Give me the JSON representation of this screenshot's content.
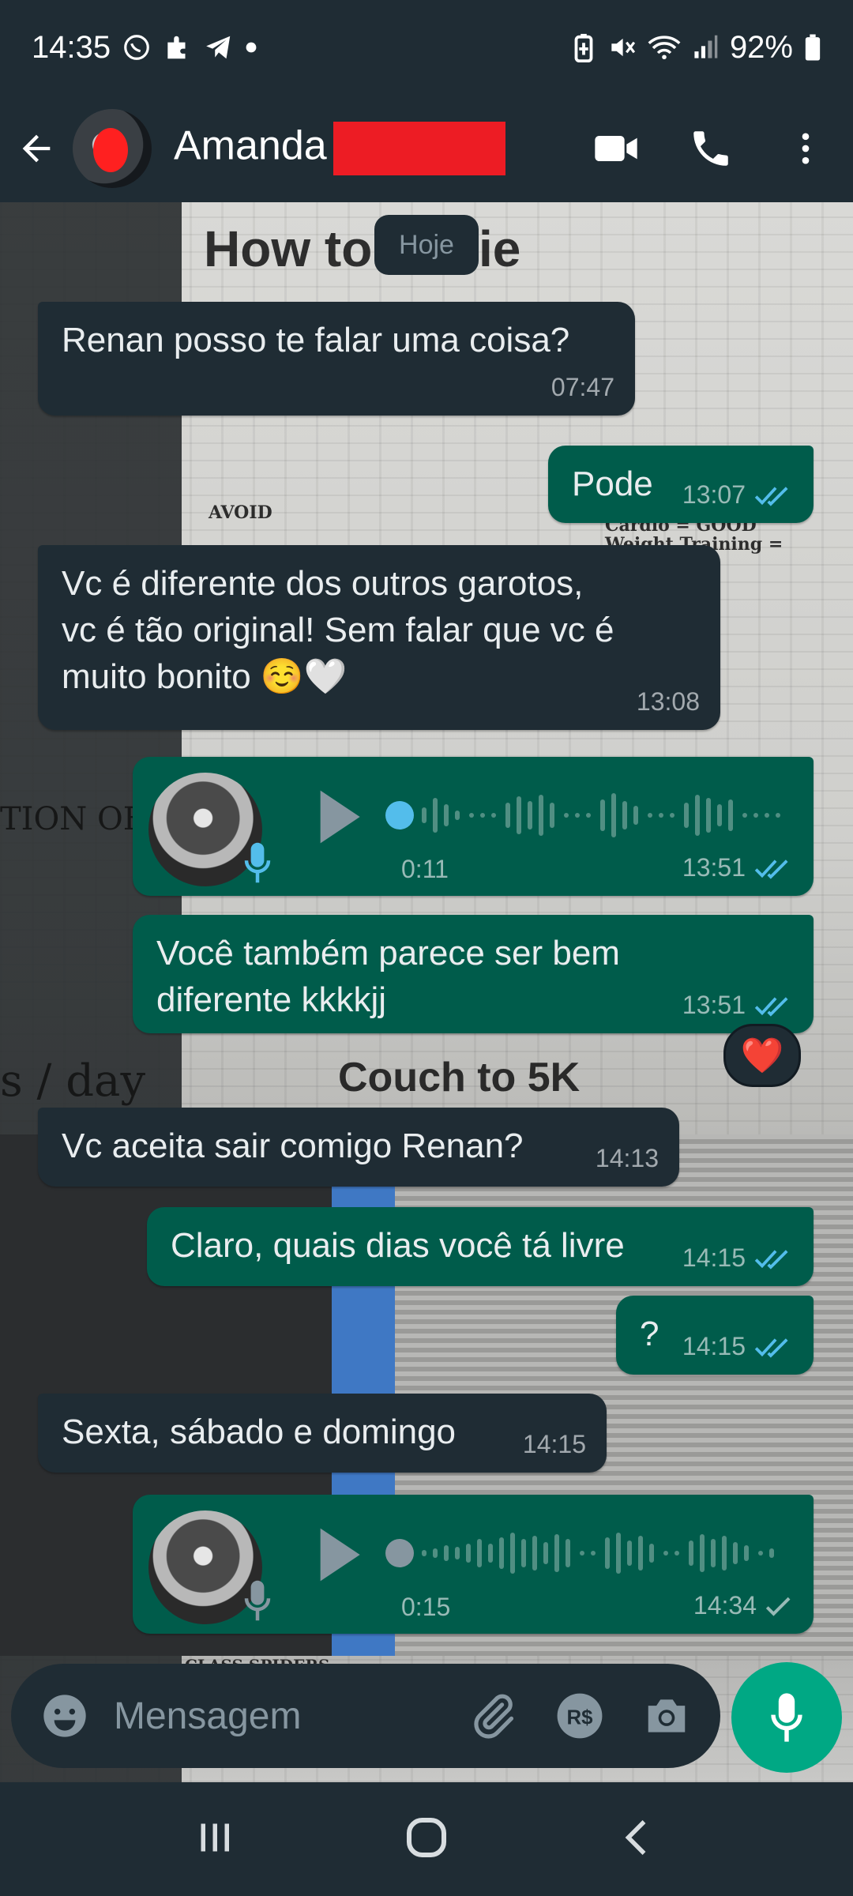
{
  "status_bar": {
    "time": "14:35",
    "battery": "92%",
    "icons_left": [
      "whatsapp-icon",
      "extension-icon",
      "telegram-icon",
      "dot-icon"
    ],
    "icons_right": [
      "battery-saver-icon",
      "mute-icon",
      "wifi-icon",
      "signal-icon",
      "battery-icon"
    ]
  },
  "header": {
    "contact_name": "Amanda",
    "actions": [
      "video-call-icon",
      "phone-icon",
      "more-icon"
    ]
  },
  "chat": {
    "date_chip": "Hoje",
    "messages": [
      {
        "dir": "in",
        "text": "Renan posso te falar uma coisa?",
        "time": "07:47"
      },
      {
        "dir": "out",
        "text": "Pode",
        "time": "13:07",
        "status": "read"
      },
      {
        "dir": "in",
        "text": "Vc é diferente dos outros garotos,\nvc é tão original! Sem falar que vc é\nmuito bonito ☺️🤍",
        "time": "13:08"
      },
      {
        "dir": "out",
        "type": "voice",
        "duration": "0:11",
        "time": "13:51",
        "status": "read",
        "played": true
      },
      {
        "dir": "out",
        "text": "Você também parece ser bem\ndiferente kkkkjj",
        "time": "13:51",
        "status": "read",
        "reaction": "❤️"
      },
      {
        "dir": "in",
        "text": "Vc aceita sair comigo Renan?",
        "time": "14:13"
      },
      {
        "dir": "out",
        "text": "Claro, quais dias você tá livre",
        "time": "14:15",
        "status": "read"
      },
      {
        "dir": "out",
        "text": "?",
        "time": "14:15",
        "status": "read"
      },
      {
        "dir": "in",
        "text": "Sexta, sábado e domingo",
        "time": "14:15"
      },
      {
        "dir": "out",
        "type": "voice",
        "duration": "0:15",
        "time": "14:34",
        "status": "sent",
        "played": false
      }
    ]
  },
  "wallpaper_text": {
    "headline": "How to",
    "headline_b": "ie",
    "couch": "Couch to 5K",
    "day": "s / day",
    "tion": "TION OF S",
    "avoid": "AVOID",
    "cardio": "Cardio = GOOD",
    "weight": "Weight Training = BADDDD",
    "bottom": "CLASS SPIDERS"
  },
  "composer": {
    "placeholder": "Mensagem",
    "icons": [
      "emoji-icon",
      "attach-icon",
      "payment-icon",
      "camera-icon"
    ],
    "mic_icon": "mic-icon"
  },
  "colors": {
    "header_bg": "#1f2c34",
    "incoming_bubble": "#1f2c34",
    "outgoing_bubble": "#005c4b",
    "accent": "#00a884",
    "read_ticks": "#53bdeb",
    "redaction": "#ed1c24"
  }
}
